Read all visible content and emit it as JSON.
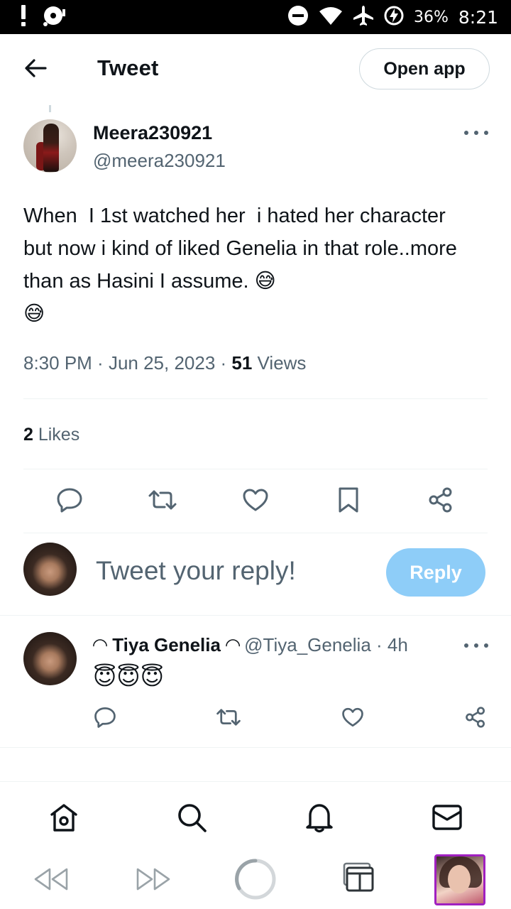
{
  "status_bar": {
    "battery_percent": "36%",
    "time": "8:21"
  },
  "header": {
    "title": "Tweet",
    "open_app_label": "Open app"
  },
  "tweet": {
    "author_name": "Meera230921",
    "author_handle": "@meera230921",
    "text": "When  I 1st watched her  i hated her character  but now i kind of liked Genelia in that role..more than as Hasini I assume.",
    "emoji": "😅",
    "emoji_line2": "😅",
    "time": "8:30 PM",
    "sep": " · ",
    "date": "Jun 25, 2023",
    "views_count": "51",
    "views_label": " Views",
    "likes_count": "2",
    "likes_label": " Likes"
  },
  "composer": {
    "placeholder": "Tweet your reply!",
    "reply_label": "Reply"
  },
  "reply": {
    "name": "◠ Tiya Genelia ◠",
    "handle": "@Tiya_Genelia",
    "sep": " · ",
    "age": "4h",
    "text": "😇😇😇"
  },
  "colors": {
    "accent": "#1d9bf0",
    "reply_button_disabled": "#8ecdf8",
    "secondary_text": "#536471",
    "divider": "#eff3f4",
    "tab_thumb_border": "#a020c0"
  },
  "icons": {
    "status_left": [
      "exclamation-icon",
      "media-icon"
    ],
    "status_right": [
      "do-not-disturb-icon",
      "wifi-icon",
      "airplane-icon",
      "battery-charging-icon"
    ],
    "actions": [
      "reply-icon",
      "retweet-icon",
      "like-icon",
      "bookmark-icon",
      "share-icon"
    ],
    "tabs": [
      "home-icon",
      "search-icon",
      "notifications-icon",
      "messages-icon"
    ],
    "browser": [
      "back-icon",
      "forward-icon",
      "reload-icon",
      "tabs-icon"
    ]
  }
}
